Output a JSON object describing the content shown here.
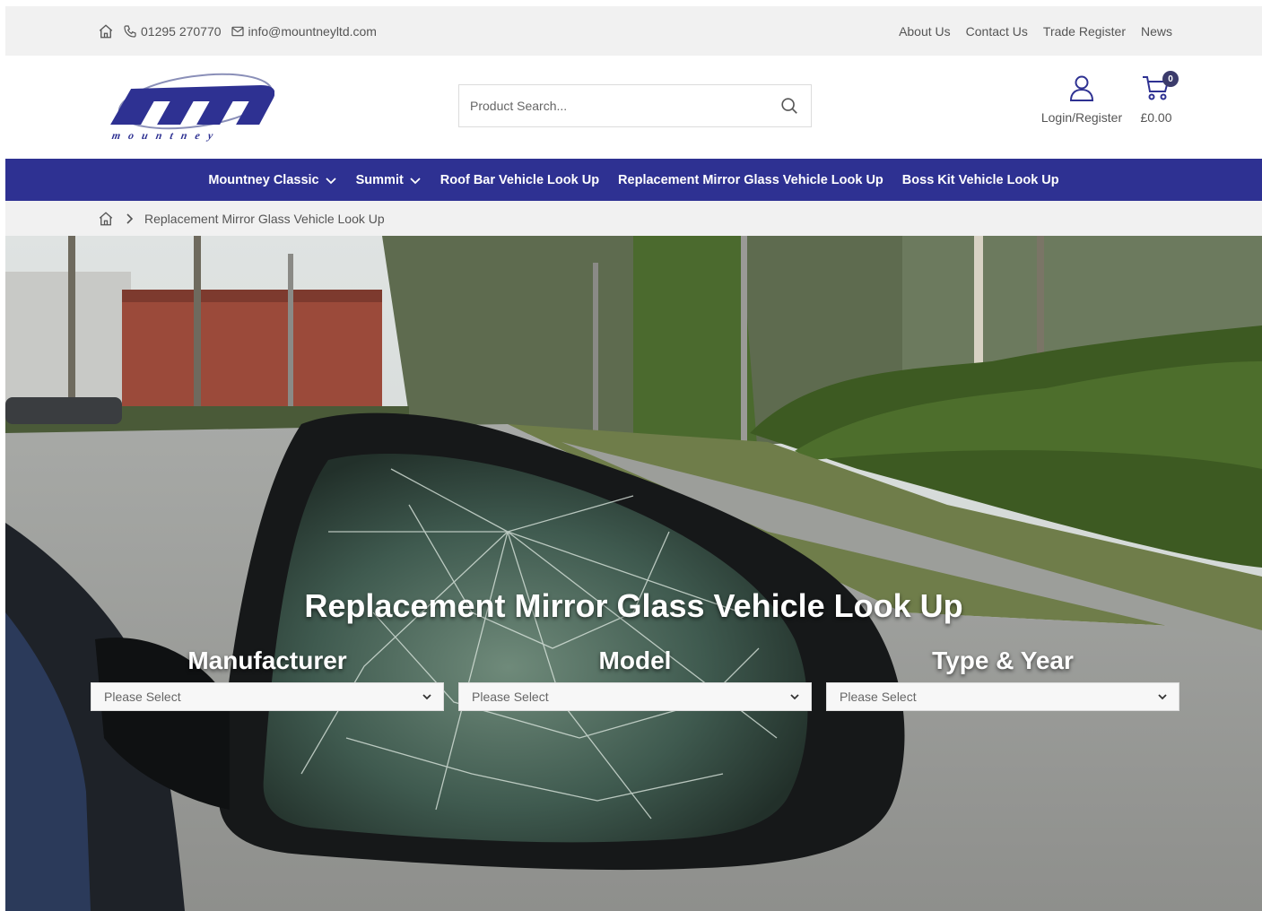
{
  "topbar": {
    "phone": "01295 270770",
    "email": "info@mountneyltd.com",
    "links": [
      "About Us",
      "Contact Us",
      "Trade Register",
      "News"
    ]
  },
  "header": {
    "logo_text": "mountney",
    "search_placeholder": "Product Search...",
    "account_label": "Login/Register",
    "cart_count": "0",
    "cart_total": "£0.00"
  },
  "nav": {
    "items": [
      {
        "label": "Mountney Classic",
        "dropdown": true
      },
      {
        "label": "Summit",
        "dropdown": true
      },
      {
        "label": "Roof Bar Vehicle Look Up",
        "dropdown": false
      },
      {
        "label": "Replacement Mirror Glass Vehicle Look Up",
        "dropdown": false
      },
      {
        "label": "Boss Kit Vehicle Look Up",
        "dropdown": false
      }
    ]
  },
  "breadcrumb": {
    "current": "Replacement Mirror Glass Vehicle Look Up"
  },
  "hero": {
    "title": "Replacement Mirror Glass Vehicle Look Up",
    "fields": [
      {
        "label": "Manufacturer",
        "value": "Please Select"
      },
      {
        "label": "Model",
        "value": "Please Select"
      },
      {
        "label": "Type & Year",
        "value": "Please Select"
      }
    ]
  },
  "colors": {
    "brand": "#2e3192",
    "topbar_bg": "#f1f1f1"
  }
}
